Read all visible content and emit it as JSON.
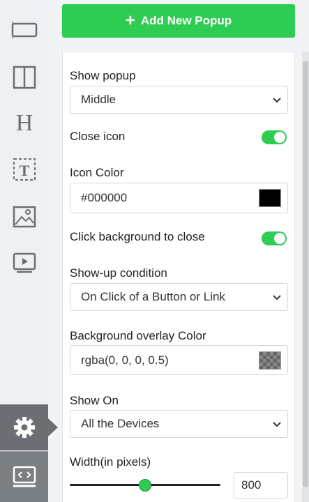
{
  "toolbar": {
    "add_label": "Add New Popup"
  },
  "rail": {
    "items": [
      {
        "icon": "section-icon"
      },
      {
        "icon": "columns-icon"
      },
      {
        "icon": "heading-icon"
      },
      {
        "icon": "text-icon"
      },
      {
        "icon": "image-icon"
      },
      {
        "icon": "video-icon"
      },
      {
        "icon": "gear-icon"
      },
      {
        "icon": "code-screen-icon"
      }
    ]
  },
  "settings": {
    "show_popup": {
      "label": "Show popup",
      "value": "Middle"
    },
    "close_icon": {
      "label": "Close icon",
      "enabled": true
    },
    "icon_color": {
      "label": "Icon Color",
      "value": "#000000",
      "swatch": "#000000"
    },
    "click_bg_close": {
      "label": "Click background to close",
      "enabled": true
    },
    "show_up_condition": {
      "label": "Show-up condition",
      "value": "On Click of a Button or Link"
    },
    "overlay_color": {
      "label": "Background overlay Color",
      "value": "rgba(0, 0, 0, 0.5)"
    },
    "show_on": {
      "label": "Show On",
      "value": "All the Devices"
    },
    "width": {
      "label": "Width(in pixels)",
      "value": "800",
      "slider_fraction": 0.5
    }
  },
  "colors": {
    "accent": "#2ecc52",
    "rail_active": "#6b6f74"
  }
}
